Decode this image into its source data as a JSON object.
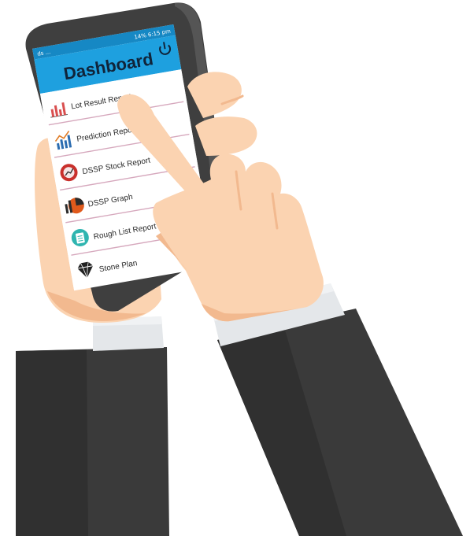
{
  "status_bar": {
    "left_text": "ds ... ",
    "right_text": "14% 6:15 pm"
  },
  "header": {
    "title": "Dashboard",
    "power_icon": "power-icon"
  },
  "menu": {
    "items": [
      {
        "label": "Lot Result Report",
        "icon": "bar-chart-icon"
      },
      {
        "label": "Prediction Report",
        "icon": "trend-chart-icon"
      },
      {
        "label": "DSSP Stock Report",
        "icon": "stock-icon"
      },
      {
        "label": "DSSP Graph",
        "icon": "pie-graph-icon"
      },
      {
        "label": "Rough List Report",
        "icon": "clipboard-icon"
      },
      {
        "label": "Stone Plan",
        "icon": "diamond-icon"
      }
    ]
  },
  "colors": {
    "header": "#1ea0df",
    "skin": "#fbd3b1",
    "skin_shade": "#f2b98f",
    "suit": "#3a3a3a",
    "suit_shade": "#2d2d2d",
    "cuff": "#e4e7ea",
    "phone_body": "#3f3f3f",
    "divider": "#d6a8bd"
  }
}
